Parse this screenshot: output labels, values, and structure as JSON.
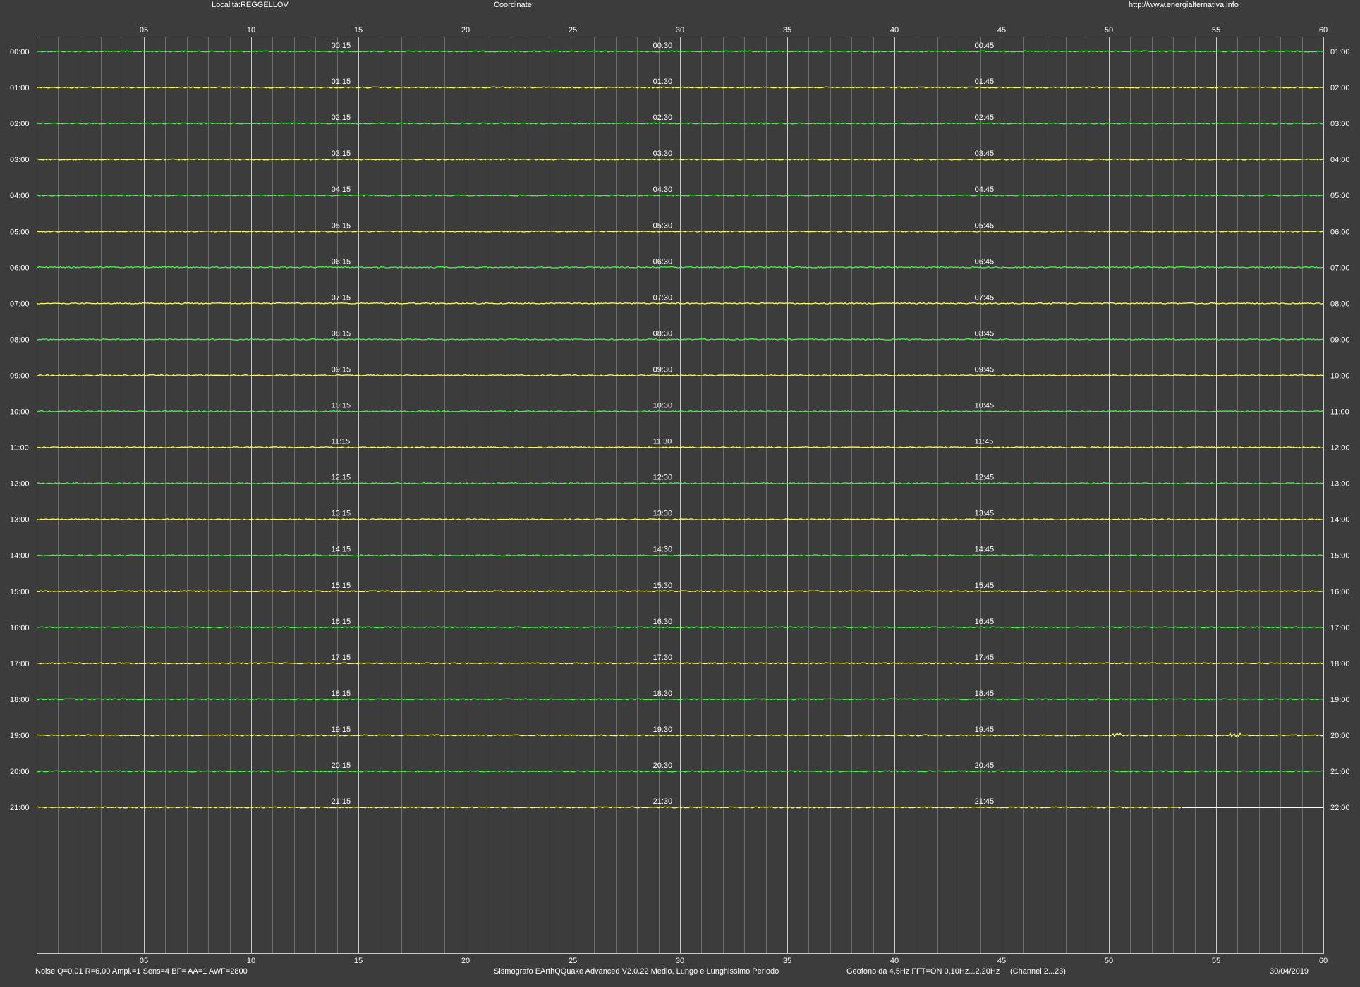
{
  "header": {
    "location": "Località:REGGELLOV",
    "coordinates": "Coordinate:",
    "url": "http://www.energialternativa.info"
  },
  "footer": {
    "noise": "Noise Q=0,01 R=6,00 Ampl.=1 Sens=4 BF= AA=1 AWF=2800",
    "software": "Sismografo  EArthQQuake Advanced V2.0.22  Medio, Lungo e Lunghissimo Periodo",
    "geofono": "Geofono da 4,5Hz FFT=ON 0,10Hz...2,20Hz",
    "channel": "(Channel 2...23)",
    "date": "30/04/2019"
  },
  "colors": {
    "background": "#3c3c3c",
    "grid_major": "#c8c8c8",
    "grid_minor": "#6e6e6e",
    "trace_green": "#3cff3c",
    "trace_yellow": "#ffff55",
    "text": "#ffffff"
  },
  "chart_data": {
    "type": "line",
    "title": "",
    "x_ticks": [
      "05",
      "10",
      "15",
      "20",
      "25",
      "30",
      "35",
      "40",
      "45",
      "50",
      "55",
      "60"
    ],
    "x_tick_values": [
      5,
      10,
      15,
      20,
      25,
      30,
      35,
      40,
      45,
      50,
      55,
      60
    ],
    "xlim": [
      0,
      60
    ],
    "minor_x_step": 1,
    "row_labels_left": [
      "00:00",
      "01:00",
      "02:00",
      "03:00",
      "04:00",
      "05:00",
      "06:00",
      "07:00",
      "08:00",
      "09:00",
      "10:00",
      "11:00",
      "12:00",
      "13:00",
      "14:00",
      "15:00",
      "16:00",
      "17:00",
      "18:00",
      "19:00",
      "20:00",
      "21:00"
    ],
    "row_labels_right": [
      "01:00",
      "02:00",
      "03:00",
      "04:00",
      "05:00",
      "06:00",
      "07:00",
      "08:00",
      "09:00",
      "10:00",
      "11:00",
      "12:00",
      "13:00",
      "14:00",
      "15:00",
      "16:00",
      "17:00",
      "18:00",
      "19:00",
      "20:00",
      "21:00",
      "22:00"
    ],
    "quarter_labels": [
      [
        "00:15",
        "00:30",
        "00:45"
      ],
      [
        "01:15",
        "01:30",
        "01:45"
      ],
      [
        "02:15",
        "02:30",
        "02:45"
      ],
      [
        "03:15",
        "03:30",
        "03:45"
      ],
      [
        "04:15",
        "04:30",
        "04:45"
      ],
      [
        "05:15",
        "05:30",
        "05:45"
      ],
      [
        "06:15",
        "06:30",
        "06:45"
      ],
      [
        "07:15",
        "07:30",
        "07:45"
      ],
      [
        "08:15",
        "08:30",
        "08:45"
      ],
      [
        "09:15",
        "09:30",
        "09:45"
      ],
      [
        "10:15",
        "10:30",
        "10:45"
      ],
      [
        "11:15",
        "11:30",
        "11:45"
      ],
      [
        "12:15",
        "12:30",
        "12:45"
      ],
      [
        "13:15",
        "13:30",
        "13:45"
      ],
      [
        "14:15",
        "14:30",
        "14:45"
      ],
      [
        "15:15",
        "15:30",
        "15:45"
      ],
      [
        "16:15",
        "16:30",
        "16:45"
      ],
      [
        "17:15",
        "17:30",
        "17:45"
      ],
      [
        "18:15",
        "18:30",
        "18:45"
      ],
      [
        "19:15",
        "19:30",
        "19:45"
      ],
      [
        "20:15",
        "20:30",
        "20:45"
      ],
      [
        "21:15",
        "21:30",
        "21:45"
      ]
    ],
    "quarter_label_minutes": [
      14,
      29,
      44
    ],
    "traces": [
      {
        "hour": "00",
        "color": "green",
        "end_minute": 60
      },
      {
        "hour": "01",
        "color": "yellow",
        "end_minute": 60
      },
      {
        "hour": "02",
        "color": "green",
        "end_minute": 60
      },
      {
        "hour": "03",
        "color": "yellow",
        "end_minute": 60
      },
      {
        "hour": "04",
        "color": "green",
        "end_minute": 60
      },
      {
        "hour": "05",
        "color": "yellow",
        "end_minute": 60
      },
      {
        "hour": "06",
        "color": "green",
        "end_minute": 60
      },
      {
        "hour": "07",
        "color": "yellow",
        "end_minute": 60
      },
      {
        "hour": "08",
        "color": "green",
        "end_minute": 60
      },
      {
        "hour": "09",
        "color": "yellow",
        "end_minute": 60
      },
      {
        "hour": "10",
        "color": "green",
        "end_minute": 60
      },
      {
        "hour": "11",
        "color": "yellow",
        "end_minute": 60
      },
      {
        "hour": "12",
        "color": "green",
        "end_minute": 60
      },
      {
        "hour": "13",
        "color": "yellow",
        "end_minute": 60
      },
      {
        "hour": "14",
        "color": "green",
        "end_minute": 60
      },
      {
        "hour": "15",
        "color": "yellow",
        "end_minute": 60
      },
      {
        "hour": "16",
        "color": "green",
        "end_minute": 60
      },
      {
        "hour": "17",
        "color": "yellow",
        "end_minute": 60
      },
      {
        "hour": "18",
        "color": "green",
        "end_minute": 60
      },
      {
        "hour": "19",
        "color": "yellow",
        "end_minute": 60,
        "events_minutes": [
          50.4,
          55.9
        ]
      },
      {
        "hour": "20",
        "color": "green",
        "end_minute": 60
      },
      {
        "hour": "21",
        "color": "yellow",
        "end_minute": 53.4
      }
    ],
    "rows_total": 25,
    "grid": true
  }
}
